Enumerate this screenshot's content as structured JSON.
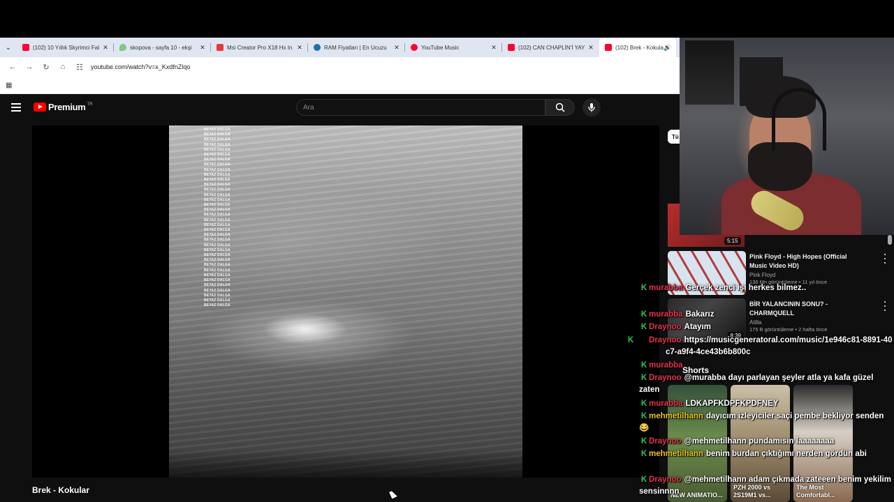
{
  "browser": {
    "tabs": [
      {
        "label": "(102) 10 Yıllık Skyrimci Fal",
        "color": "#ff0033"
      },
      {
        "label": "skopova - sayfa 10 - ekşi",
        "color": "#81c784"
      },
      {
        "label": "Msi Creator Pro X18 Hx In",
        "color": "#e53935"
      },
      {
        "label": "RAM Fiyatları | En Ucuzu",
        "color": "#1f6fb2"
      },
      {
        "label": "YouTube Music",
        "color": "#ff0033"
      },
      {
        "label": "(102) CAN CHAPLİN'İ YAY",
        "color": "#ff0033"
      },
      {
        "label": "(102) Brek - Kokular",
        "color": "#ff0033"
      }
    ],
    "url": "youtube.com/watch?v=x_KxdfnZlqo"
  },
  "youtube": {
    "logo_text": "Premium",
    "logo_badge": "TR",
    "search_placeholder": "Ara",
    "video_title": "Brek - Kokular",
    "overlay_text": "BEYAZ DALGA",
    "overlay_lines": 36,
    "chip_label": "Tü"
  },
  "recommendations": {
    "top_duration": "5:15",
    "items": [
      {
        "title": "Pink Floyd - High Hopes (Official Music Video HD)",
        "channel": "Pink Floyd",
        "stats": "136 Mn görüntüleme • 11 yıl önce",
        "duration": ""
      },
      {
        "title": "BİR YALANCININ SONU? - CHARMQUELL",
        "channel": "Atilla",
        "stats": "175 B görüntüleme • 2 hafta önce",
        "duration": "8:39"
      }
    ],
    "shorts_label": "Shorts",
    "shorts": [
      {
        "title": "NEW ANIMATIO..."
      },
      {
        "title": "PZH 2000 vs 2S19M1 vs..."
      },
      {
        "title": "The Most Comfortabl..."
      }
    ]
  },
  "chat": {
    "messages": [
      {
        "user": "murabba",
        "user_color": "#e2334a",
        "text": "Gerçek zenci işi herkes bilmez.."
      },
      {
        "user": "murabba",
        "user_color": "#e2334a",
        "text": "Bakarız"
      },
      {
        "user": "Draynoo",
        "user_color": "#e2334a",
        "text": "Atayım"
      },
      {
        "user": "Draynoo",
        "user_color": "#e2334a",
        "text": "https://musicgeneratoral.com/music/1e946c81-8891-40c7-a9f4-4ce43b6b800c"
      },
      {
        "user": "murabba",
        "user_color": "#e2334a",
        "text": ""
      },
      {
        "user": "Draynoo",
        "user_color": "#e2334a",
        "text": "@murabba dayı parlayan şeyler atla ya kafa güzel zaten"
      },
      {
        "user": "murabba",
        "user_color": "#e2334a",
        "text": "LDKAPFKDPFKPDFNEY"
      },
      {
        "user": "mehmetilhann",
        "user_color": "#e8c21b",
        "text": "dayıcım izleyiciler saçi pembe bekliyor senden 😂"
      },
      {
        "user": "Draynoo",
        "user_color": "#e2334a",
        "text": "@mehmetilhann pundamısın laaaaaaaa"
      },
      {
        "user": "mehmetilhann",
        "user_color": "#e8c21b",
        "text": "benim burdan çıktığımı nerden gördün abi"
      },
      {
        "user": "Draynoo",
        "user_color": "#e2334a",
        "text": "@mehmetilhann adam çıkmada zateeen benim yekilim sensinnnn"
      }
    ]
  }
}
